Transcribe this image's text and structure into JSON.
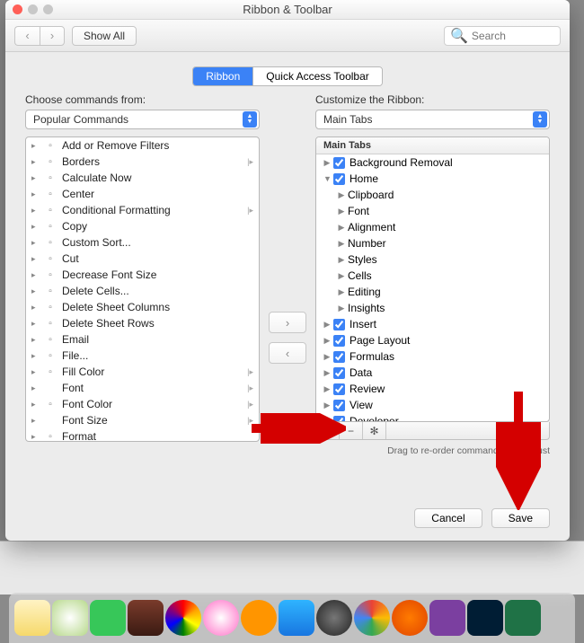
{
  "window": {
    "title": "Ribbon & Toolbar"
  },
  "toolbar": {
    "show_all": "Show All",
    "search_placeholder": "Search"
  },
  "segmented": {
    "ribbon": "Ribbon",
    "quick_access": "Quick Access Toolbar"
  },
  "left": {
    "label": "Choose commands from:",
    "dropdown": "Popular Commands",
    "items": [
      {
        "icon": "filter",
        "label": "Add or Remove Filters"
      },
      {
        "icon": "borders",
        "label": "Borders",
        "sub": true
      },
      {
        "icon": "calc",
        "label": "Calculate Now"
      },
      {
        "icon": "center",
        "label": "Center"
      },
      {
        "icon": "cond",
        "label": "Conditional Formatting",
        "sub": true
      },
      {
        "icon": "copy",
        "label": "Copy"
      },
      {
        "icon": "sort",
        "label": "Custom Sort..."
      },
      {
        "icon": "cut",
        "label": "Cut"
      },
      {
        "icon": "fontdn",
        "label": "Decrease Font Size"
      },
      {
        "icon": "delcell",
        "label": "Delete Cells..."
      },
      {
        "icon": "delcol",
        "label": "Delete Sheet Columns"
      },
      {
        "icon": "delrow",
        "label": "Delete Sheet Rows"
      },
      {
        "icon": "email",
        "label": "Email"
      },
      {
        "icon": "file",
        "label": "File..."
      },
      {
        "icon": "fill",
        "label": "Fill Color",
        "sub": true
      },
      {
        "icon": "",
        "label": "Font",
        "sub": true
      },
      {
        "icon": "fontc",
        "label": "Font Color",
        "sub": true
      },
      {
        "icon": "",
        "label": "Font Size",
        "sub": true
      },
      {
        "icon": "fmt",
        "label": "Format"
      }
    ]
  },
  "right": {
    "label": "Customize the Ribbon:",
    "dropdown": "Main Tabs",
    "header": "Main Tabs",
    "tabs": [
      {
        "indent": 0,
        "tri": "▶",
        "check": true,
        "label": "Background Removal"
      },
      {
        "indent": 0,
        "tri": "▼",
        "check": true,
        "label": "Home"
      },
      {
        "indent": 1,
        "tri": "▶",
        "check": null,
        "label": "Clipboard"
      },
      {
        "indent": 1,
        "tri": "▶",
        "check": null,
        "label": "Font"
      },
      {
        "indent": 1,
        "tri": "▶",
        "check": null,
        "label": "Alignment"
      },
      {
        "indent": 1,
        "tri": "▶",
        "check": null,
        "label": "Number"
      },
      {
        "indent": 1,
        "tri": "▶",
        "check": null,
        "label": "Styles"
      },
      {
        "indent": 1,
        "tri": "▶",
        "check": null,
        "label": "Cells"
      },
      {
        "indent": 1,
        "tri": "▶",
        "check": null,
        "label": "Editing"
      },
      {
        "indent": 1,
        "tri": "▶",
        "check": null,
        "label": "Insights"
      },
      {
        "indent": 0,
        "tri": "▶",
        "check": true,
        "label": "Insert"
      },
      {
        "indent": 0,
        "tri": "▶",
        "check": true,
        "label": "Page Layout"
      },
      {
        "indent": 0,
        "tri": "▶",
        "check": true,
        "label": "Formulas"
      },
      {
        "indent": 0,
        "tri": "▶",
        "check": true,
        "label": "Data"
      },
      {
        "indent": 0,
        "tri": "▶",
        "check": true,
        "label": "Review"
      },
      {
        "indent": 0,
        "tri": "▶",
        "check": true,
        "label": "View"
      },
      {
        "indent": 0,
        "tri": "",
        "check": true,
        "label": "Developer"
      }
    ],
    "hint": "Drag to re-order commands within cust"
  },
  "footer": {
    "cancel": "Cancel",
    "save": "Save"
  },
  "ctrl": {
    "plus": "+",
    "minus": "−",
    "gear": "✻"
  }
}
